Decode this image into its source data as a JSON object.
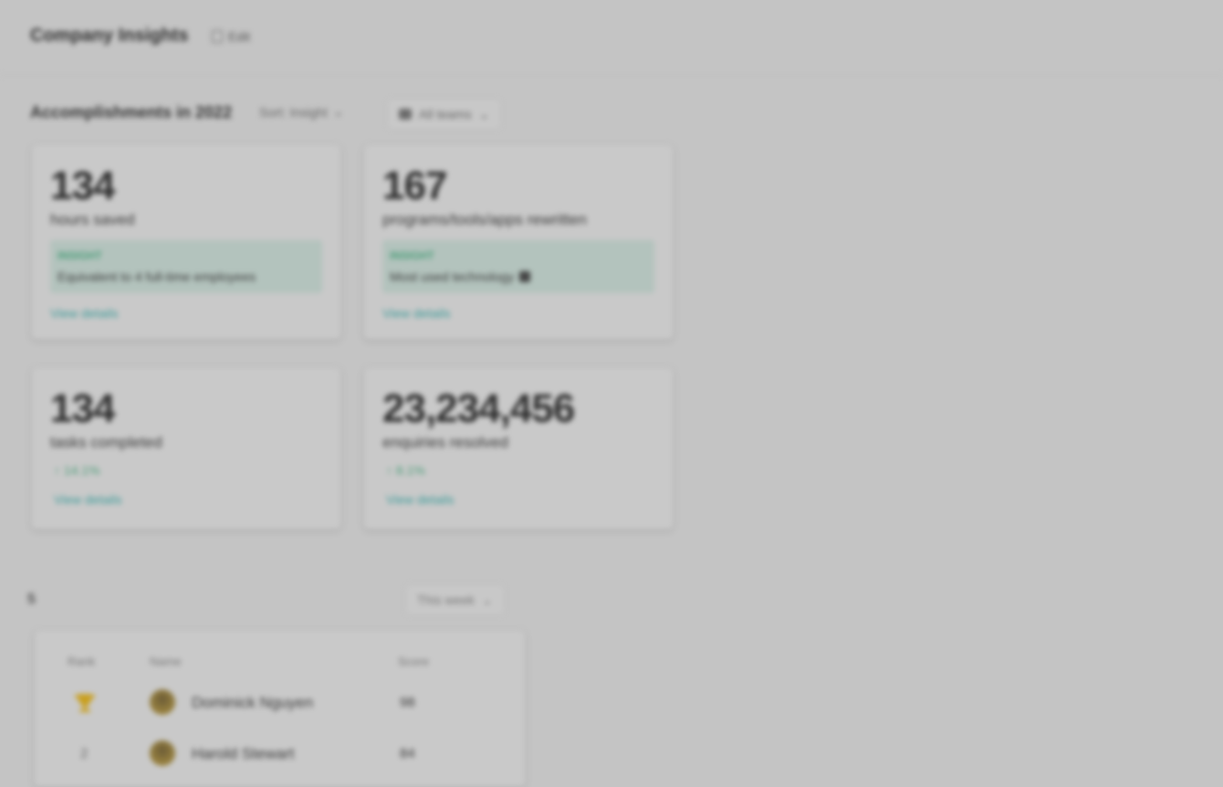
{
  "header": {
    "title": "Company Insights",
    "edit_label": "Edit"
  },
  "section": {
    "title": "Accomplishments in 2022",
    "sort_label": "Sort: Insight",
    "filter_label": "All teams"
  },
  "cards": [
    {
      "number": "134",
      "label": "hours saved",
      "insight_tag": "INSIGHT",
      "insight_text": "Equivalent to 4 full-time employees",
      "details_link": "View details"
    },
    {
      "number": "167",
      "label": "programs/tools/apps rewritten",
      "insight_tag": "INSIGHT",
      "insight_text": "Most used technology",
      "details_link": "View details"
    },
    {
      "number": "134",
      "label": "tasks completed",
      "trend": "↑ 14.1%",
      "details_link": "View details"
    },
    {
      "number": "23,234,456",
      "label": "enquiries resolved",
      "trend": "↑ 8.1%",
      "details_link": "View details"
    }
  ],
  "leaderboard": {
    "title": "5",
    "view_label": "This week",
    "columns": {
      "rank": "Rank",
      "name": "Name",
      "score": "Score"
    },
    "rows": [
      {
        "rank": "1",
        "name": "Dominick Nguyen",
        "score": "98"
      },
      {
        "rank": "2",
        "name": "Harold Stewart",
        "score": "84"
      }
    ]
  },
  "colors": {
    "insight_bg": "#b3c3bd",
    "positive": "#4a9d78",
    "link": "#3a9a98",
    "trophy": "#c9a020"
  }
}
